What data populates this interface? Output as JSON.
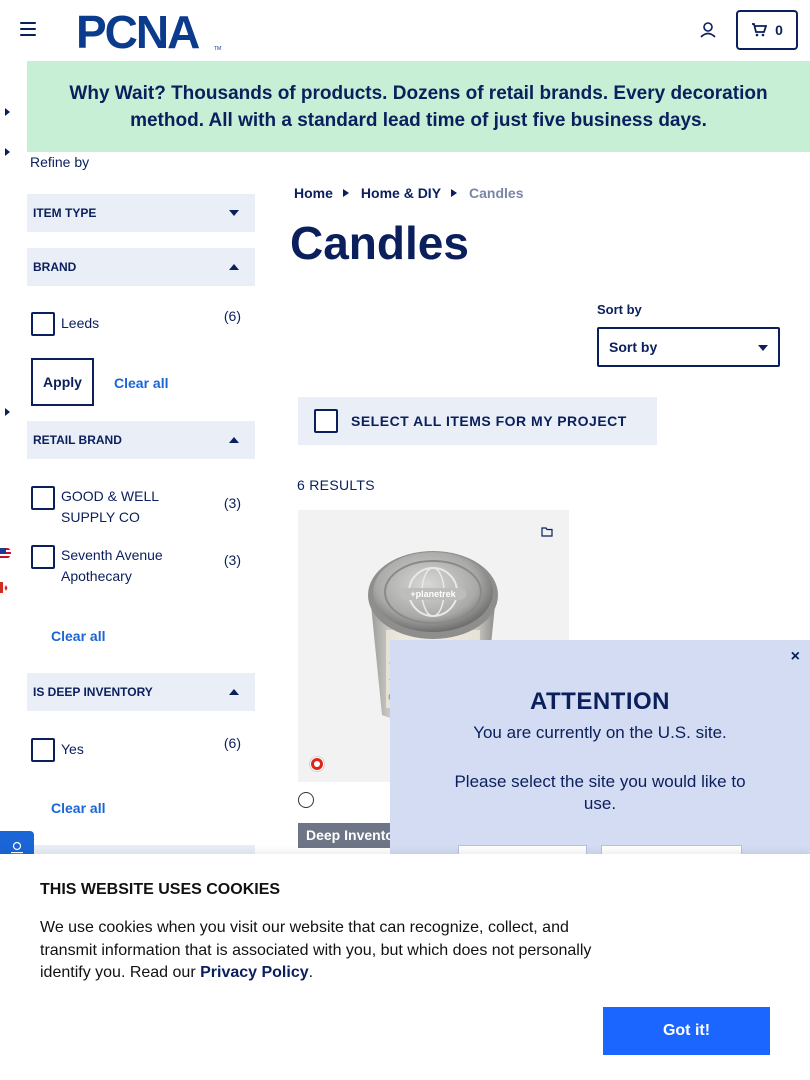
{
  "header": {
    "brand_logo_text": "PCNA",
    "cart_count": "0"
  },
  "banner": {
    "text": "Why Wait? Thousands of products. Dozens of retail brands. Every decoration method. All with a standard lead time of just five business days."
  },
  "sidebar": {
    "refine_label": "Refine by",
    "filters": [
      {
        "title": "ITEM TYPE"
      },
      {
        "title": "BRAND",
        "options": [
          {
            "label": "Leeds",
            "count": "(6)"
          }
        ],
        "apply_label": "Apply",
        "clear_label": "Clear all"
      },
      {
        "title": "RETAIL BRAND",
        "options": [
          {
            "label": "GOOD & WELL SUPPLY CO",
            "count": "(3)"
          },
          {
            "label": "Seventh Avenue Apothecary",
            "count": "(3)"
          }
        ],
        "clear_label": "Clear all"
      },
      {
        "title": "IS DEEP INVENTORY",
        "options": [
          {
            "label": "Yes",
            "count": "(6)"
          }
        ],
        "clear_label": "Clear all"
      }
    ]
  },
  "breadcrumb": {
    "items": [
      "Home",
      "Home & DIY",
      "Candles"
    ]
  },
  "main": {
    "page_title": "Candles",
    "sort_label": "Sort by",
    "sort_value": "Sort by",
    "select_all_label": "SELECT ALL ITEMS FOR MY PROJECT",
    "results_text": "6 RESULTS"
  },
  "product": {
    "tin_brand": "+planetrek",
    "badge": "Deep Inventory"
  },
  "modal": {
    "close_glyph": "×",
    "title": "ATTENTION",
    "line1": "You are currently on the U.S. site.",
    "line2": "Please select the site you would like to use."
  },
  "cookie": {
    "title": "THIS WEBSITE USES COOKIES",
    "text_before": "We use cookies when you visit our website that can recognize, collect, and transmit information that is associated with you, but which does not personally identify you. Read our ",
    "privacy_link": "Privacy Policy",
    "text_after": ".",
    "button_label": "Got it!"
  },
  "colors": {
    "navy": "#0a1f5c",
    "banner_green": "#c6efd6",
    "filter_bg": "#e9eef7",
    "link_blue": "#1a66d6",
    "cta_blue": "#1a66ff",
    "modal_bg": "#d3dcf2"
  },
  "icons": {
    "menu": "hamburger-icon",
    "account": "user-icon",
    "cart": "cart-icon",
    "project": "folder-icon"
  }
}
